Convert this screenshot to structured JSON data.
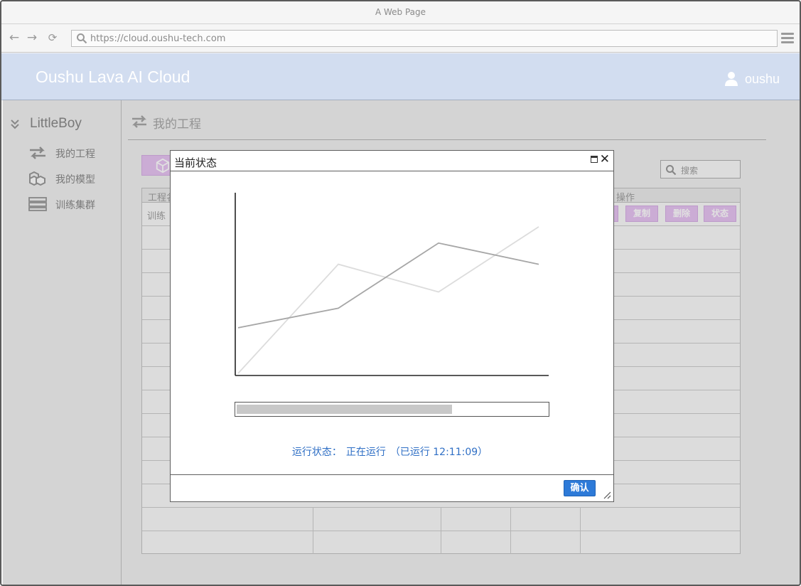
{
  "browser": {
    "title": "A Web Page",
    "url": "https://cloud.oushu-tech.com"
  },
  "header": {
    "brand": "Oushu Lava AI Cloud",
    "username": "oushu"
  },
  "sidebar": {
    "group_title": "LittleBoy",
    "items": [
      {
        "label": "我的工程",
        "icon": "arrows-exchange-icon"
      },
      {
        "label": "我的模型",
        "icon": "cubes-icon"
      },
      {
        "label": "训练集群",
        "icon": "server-icon"
      }
    ]
  },
  "main": {
    "title": "我的工程",
    "search_placeholder": "搜索",
    "table": {
      "header_first": "工程名",
      "header_ops": "操作",
      "first_row_name": "训练",
      "row_buttons": [
        "复制",
        "删除",
        "状态"
      ]
    }
  },
  "dialog": {
    "title": "当前状态",
    "status_label": "运行状态：",
    "status_value": "正在运行",
    "status_elapsed": "（已运行 12:11:09）",
    "confirm_label": "确认",
    "progress": 0.69
  },
  "chart_data": {
    "type": "line",
    "x": [
      0,
      1,
      2,
      3
    ],
    "series": [
      {
        "values": [
          0.28,
          0.4,
          0.8,
          0.67
        ],
        "color": "#a6a6a6"
      },
      {
        "values": [
          0.0,
          0.67,
          0.5,
          0.9
        ],
        "color": "#dcdcdc"
      }
    ],
    "ylim": [
      0,
      1
    ],
    "grid": false
  },
  "colors": {
    "header_bg": "#d2ddf0",
    "accent_button": "#e8c4f3",
    "confirm_button": "#2d7ad8",
    "status_text": "#2f6fc5"
  }
}
